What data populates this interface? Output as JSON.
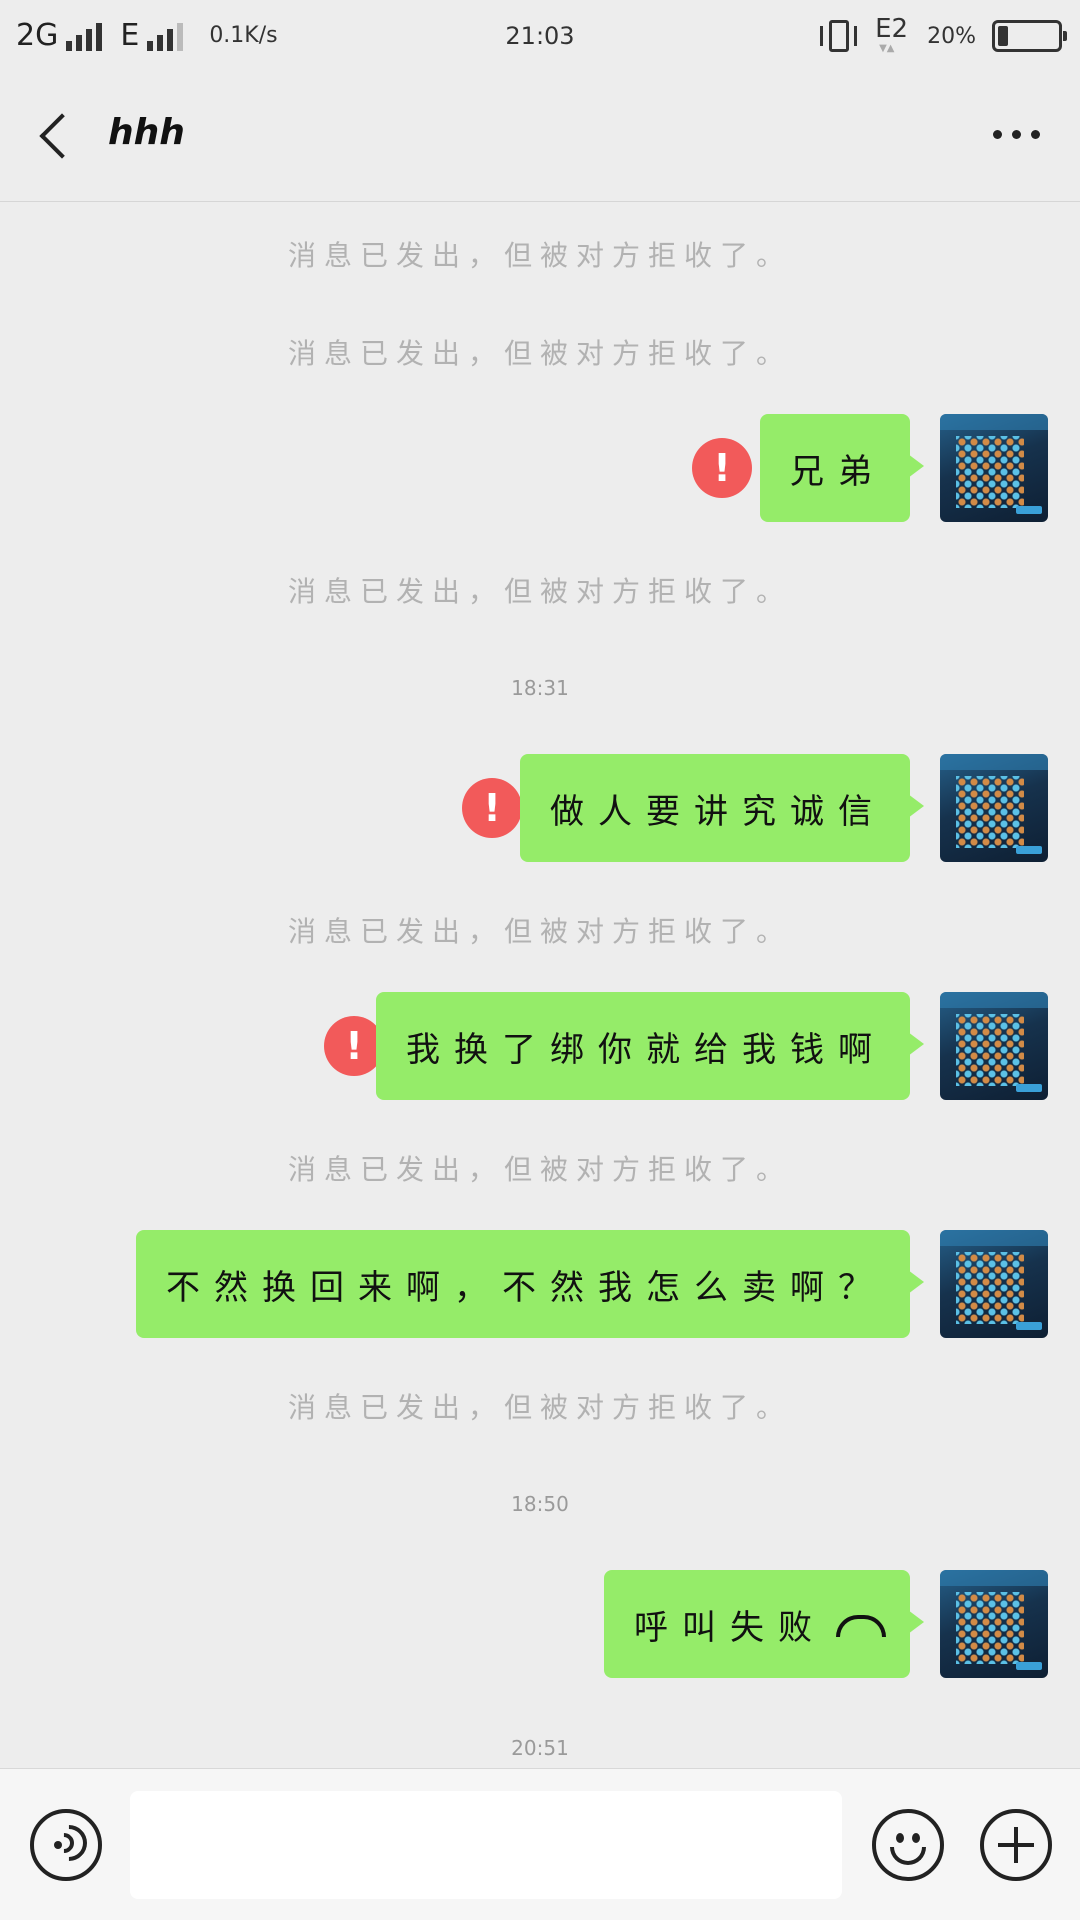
{
  "status_bar": {
    "network1": "2G",
    "network2": "E",
    "speed": "0.1K/s",
    "time": "21:03",
    "sim": "E2",
    "battery_pct": "20%",
    "battery_level": 0.2
  },
  "header": {
    "title": "hhh",
    "back_icon": "chevron-left-icon",
    "more_icon": "more-dots-icon"
  },
  "messages": {
    "rejected_notice": "消息已发出，但被对方拒收了。",
    "sys1": "消息已发出，但被对方拒收了。",
    "sys2": "消息已发出，但被对方拒收了。",
    "msg1": "兄弟",
    "sys3": "消息已发出，但被对方拒收了。",
    "time1": "18:31",
    "msg2": "做人要讲究诚信",
    "sys4": "消息已发出，但被对方拒收了。",
    "msg3": "我换了绑你就给我钱啊",
    "sys5": "消息已发出，但被对方拒收了。",
    "msg4": "不然换回来啊，不然我怎么卖啊？",
    "sys6": "消息已发出，但被对方拒收了。",
    "time2": "18:50",
    "msg5": "呼叫失败",
    "time3": "20:51",
    "error_mark": "!"
  },
  "input_bar": {
    "voice_icon": "voice-icon",
    "emoji_icon": "emoji-icon",
    "plus_icon": "plus-icon",
    "text_value": ""
  },
  "colors": {
    "bubble": "#95ec69",
    "error": "#f25a5a",
    "background": "#ededed"
  }
}
